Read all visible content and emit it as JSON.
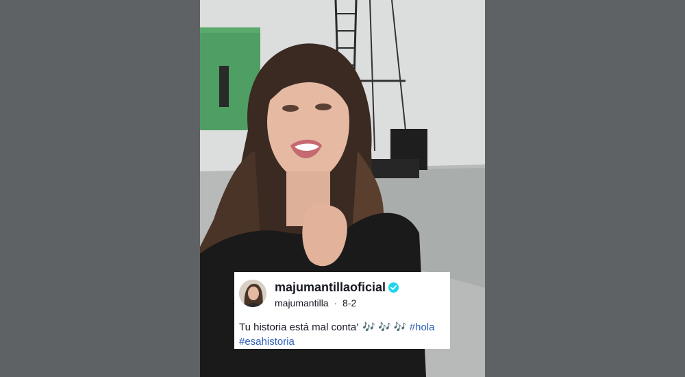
{
  "post": {
    "username": "majumantillaoficial",
    "handle": "majumantilla",
    "separator": "·",
    "date": "8-2",
    "caption": "Tu historia está mal conta'",
    "notes": "🎶 🎶 🎶",
    "hashtags": [
      "#hola",
      "#esahistoria"
    ],
    "verified": true
  },
  "colors": {
    "background": "#5e6264",
    "verified_badge": "#20d5ec",
    "hashtag": "#2b5db8"
  },
  "icons": {
    "verified": "verified-check-icon",
    "avatar": "profile-photo"
  }
}
